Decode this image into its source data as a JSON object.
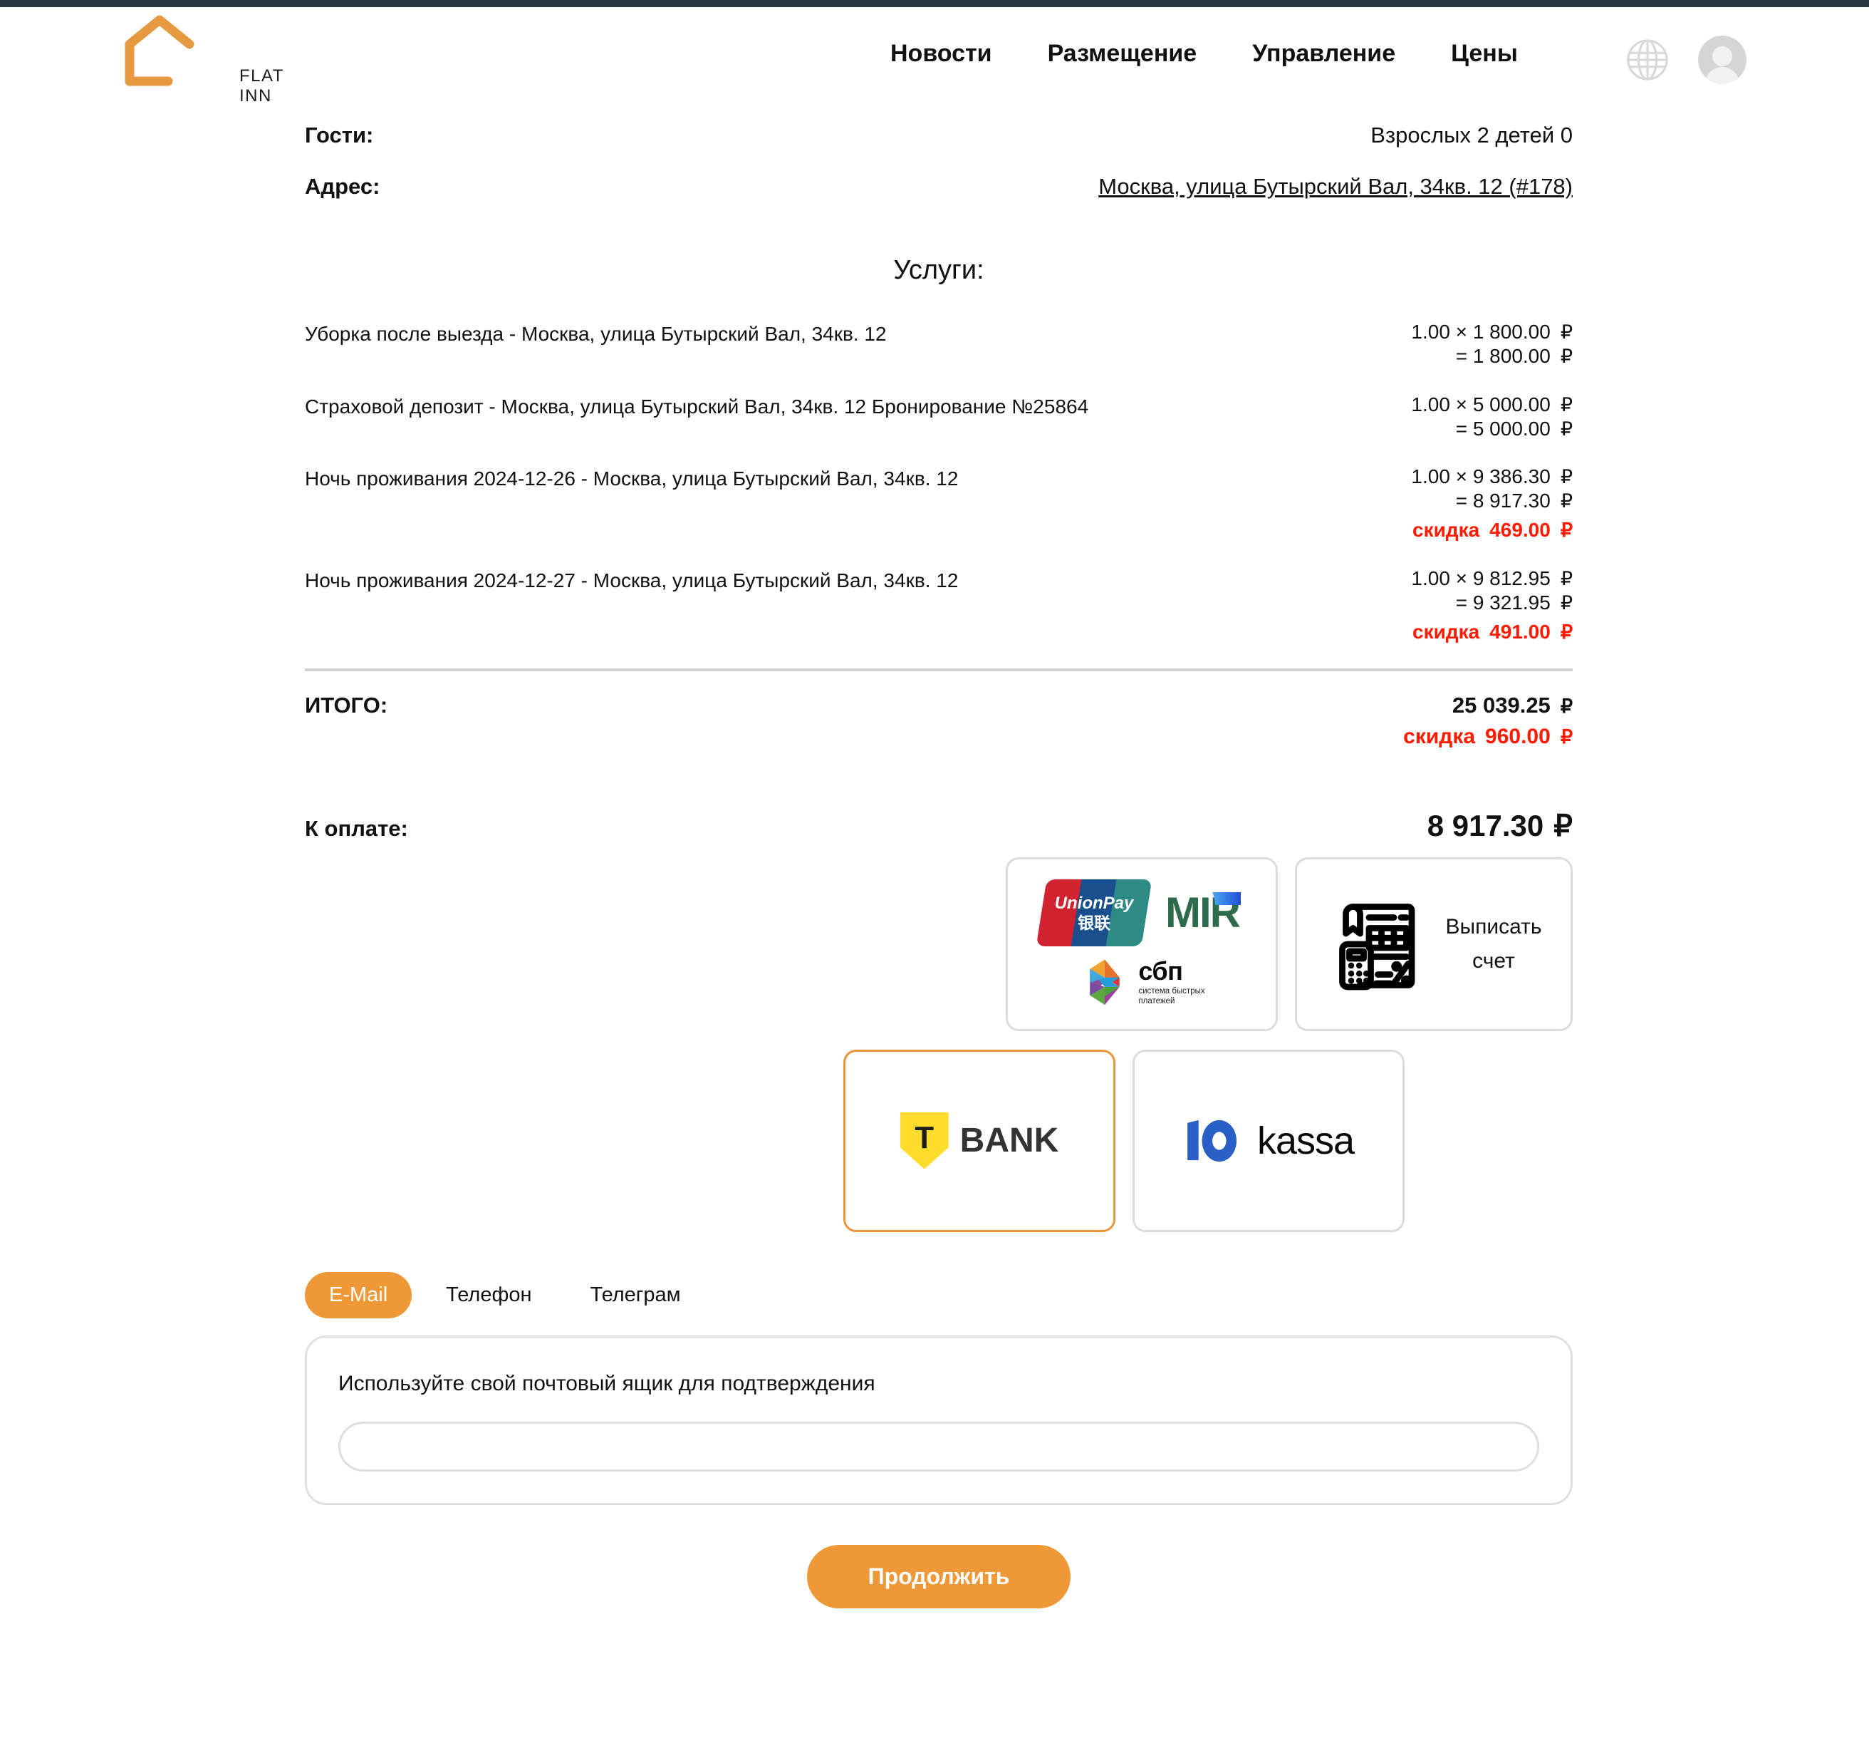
{
  "header": {
    "logo_text": "FLAT INN",
    "nav": [
      {
        "label": "Новости"
      },
      {
        "label": "Размещение"
      },
      {
        "label": "Управление"
      },
      {
        "label": "Цены"
      }
    ],
    "language_icon": "globe-icon",
    "account_icon": "user-avatar-icon"
  },
  "booking": {
    "guests_label": "Гости:",
    "guests_value": "Взрослых 2 детей 0",
    "address_label": "Адрес:",
    "address_value": "Москва, улица Бутырский Вал, 34кв. 12 (#178)"
  },
  "services": {
    "title": "Услуги:",
    "items": [
      {
        "name": "Уборка после выезда - Москва, улица Бутырский Вал, 34кв. 12",
        "qty_line": "1.00 × 1 800.00",
        "sum_line": "= 1 800.00",
        "discount_label": "",
        "discount_value": "",
        "currency": "₽"
      },
      {
        "name": "Страховой депозит - Москва, улица Бутырский Вал, 34кв. 12 Бронирование №25864",
        "qty_line": "1.00 × 5 000.00",
        "sum_line": "= 5 000.00",
        "discount_label": "",
        "discount_value": "",
        "currency": "₽"
      },
      {
        "name": "Ночь проживания 2024-12-26 - Москва, улица Бутырский Вал, 34кв. 12",
        "qty_line": "1.00 × 9 386.30",
        "sum_line": "= 8 917.30",
        "discount_label": "скидка",
        "discount_value": "469.00",
        "currency": "₽"
      },
      {
        "name": "Ночь проживания 2024-12-27 - Москва, улица Бутырский Вал, 34кв. 12",
        "qty_line": "1.00 × 9 812.95",
        "sum_line": "= 9 321.95",
        "discount_label": "скидка",
        "discount_value": "491.00",
        "currency": "₽"
      }
    ]
  },
  "totals": {
    "total_label": "ИТОГО:",
    "total_value": "25 039.25",
    "total_currency": "₽",
    "discount_label": "скидка",
    "discount_value": "960.00",
    "discount_currency": "₽",
    "payable_label": "К оплате:",
    "payable_value": "8 917.30",
    "payable_currency": "₽"
  },
  "payment_methods": {
    "cards": {
      "unionpay_text_top": "UnionPay",
      "unionpay_text_bottom": "银联",
      "mir_text": "MIR",
      "sbp_text": "сбп",
      "sbp_sub_line1": "система быстрых",
      "sbp_sub_line2": "платежей"
    },
    "invoice": {
      "label_line1": "Выписать",
      "label_line2": "счет"
    },
    "tbank": {
      "mark": "Т",
      "name": "BANK"
    },
    "yookassa": {
      "name": "kassa"
    },
    "selected": "tbank"
  },
  "contact": {
    "tabs": [
      {
        "label": "E-Mail",
        "active": true
      },
      {
        "label": "Телефон",
        "active": false
      },
      {
        "label": "Телеграм",
        "active": false
      }
    ],
    "hint": "Используйте свой почтовый ящик для подтверждения",
    "input_value": "",
    "input_placeholder": ""
  },
  "footer": {
    "continue_label": "Продолжить"
  },
  "colors": {
    "accent": "#ee9838",
    "discount_red": "#ff1a00",
    "top_strip": "#2b3643",
    "divider": "#d0d0d0"
  }
}
